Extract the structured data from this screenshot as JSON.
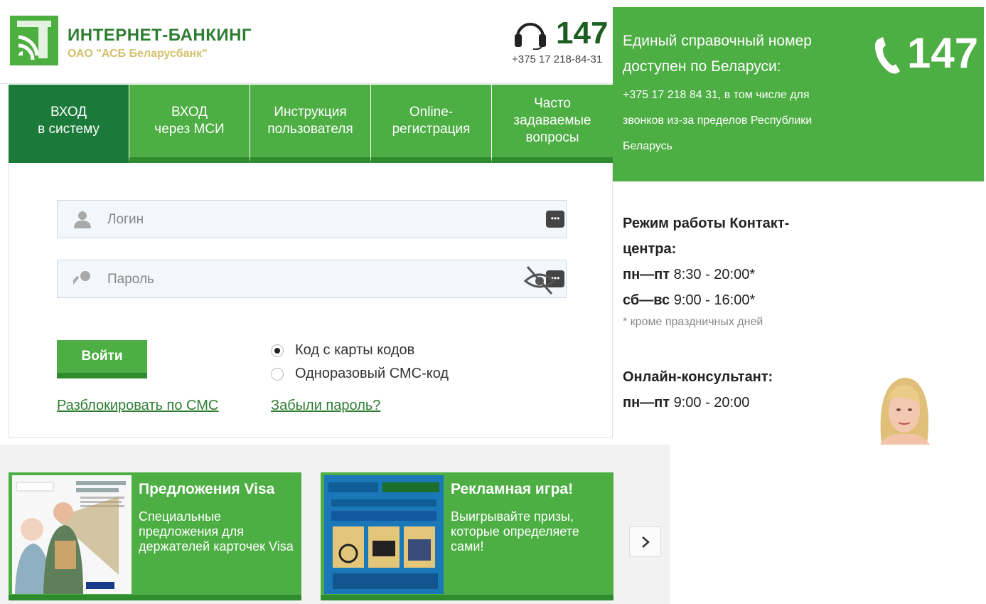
{
  "header": {
    "logo_title": "ИНТЕРНЕТ-БАНКИНГ",
    "logo_subtitle": "ОАО \"АСБ Беларусбанк\"",
    "short_number": "147",
    "phone": "+375 17 218-84-31"
  },
  "nav": {
    "tabs": [
      {
        "label_line1": "ВХОД",
        "label_line2": "в систему"
      },
      {
        "label_line1": "ВХОД",
        "label_line2": "через МСИ"
      },
      {
        "label_line1": "Инструкция",
        "label_line2": "пользователя"
      },
      {
        "label_line1": "Online-",
        "label_line2": "регистрация"
      },
      {
        "label_line1": "Часто",
        "label_line2": "задаваемые",
        "label_line3": "вопросы"
      }
    ]
  },
  "login": {
    "login_placeholder": "Логин",
    "password_placeholder": "Пароль",
    "password_reveal_icon": "eye-off-icon",
    "submit_label": "Войти",
    "options": [
      {
        "label": "Код с карты кодов",
        "checked": true
      },
      {
        "label": "Одноразовый СМС-код",
        "checked": false
      }
    ],
    "unlock_link": "Разблокировать по СМС",
    "forgot_link": "Забыли пароль?"
  },
  "info": {
    "title": "Единый справочный номер доступен по Беларуси:",
    "text": "+375 17 218 84 31, в том числе для звонков из-за пределов Республики Беларусь",
    "short_number": "147"
  },
  "hours": {
    "title": "Режим работы Контакт-центра:",
    "weekdays_label": "пн—пт",
    "weekdays_time": "8:30 - 20:00*",
    "weekend_label": "сб—вс",
    "weekend_time": "9:00 - 16:00*",
    "note": "* кроме праздничных дней"
  },
  "consultant": {
    "title": "Онлайн-консультант:",
    "days_label": "пн—пт",
    "time": "9:00 - 20:00"
  },
  "promos": [
    {
      "title": "Предложения Visa",
      "text": "Специальные предложения для держателей карточек Visa"
    },
    {
      "title": "Рекламная игра!",
      "text": "Выигрывайте призы, которые определяете сами!"
    }
  ],
  "colors": {
    "brand_green": "#4cae43",
    "dark_green": "#1b7a3a",
    "link_green": "#2e7d32"
  }
}
